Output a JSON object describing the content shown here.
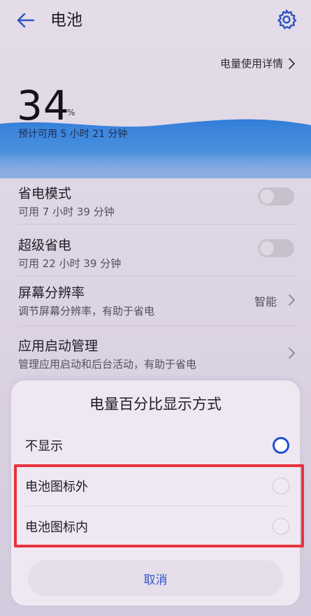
{
  "header": {
    "title": "电池",
    "back_icon": "arrow-left-icon",
    "settings_icon": "gear-icon"
  },
  "usage_detail": {
    "label": "电量使用详情",
    "icon": "chevron-right-icon"
  },
  "battery": {
    "percent": "34",
    "unit": "%",
    "remaining": "预计可用 5 小时 21 分钟",
    "level": 0.34
  },
  "settings": [
    {
      "title": "省电模式",
      "subtitle": "可用 7 小时 39 分钟",
      "control": "toggle",
      "on": false
    },
    {
      "title": "超级省电",
      "subtitle": "可用 22 小时 39 分钟",
      "control": "toggle",
      "on": false
    },
    {
      "title": "屏幕分辨率",
      "subtitle": "调节屏幕分辨率，有助于省电",
      "control": "value",
      "value": "智能"
    },
    {
      "title": "应用启动管理",
      "subtitle": "管理应用启动和后台活动，有助于省电",
      "control": "chevron"
    }
  ],
  "dialog": {
    "title": "电量百分比显示方式",
    "options": [
      {
        "label": "不显示",
        "selected": true
      },
      {
        "label": "电池图标外",
        "selected": false
      },
      {
        "label": "电池图标内",
        "selected": false
      }
    ],
    "cancel_label": "取消"
  },
  "colors": {
    "accent": "#1f4fd6",
    "highlight": "#e8323d",
    "wave": "#2f7fe0"
  }
}
